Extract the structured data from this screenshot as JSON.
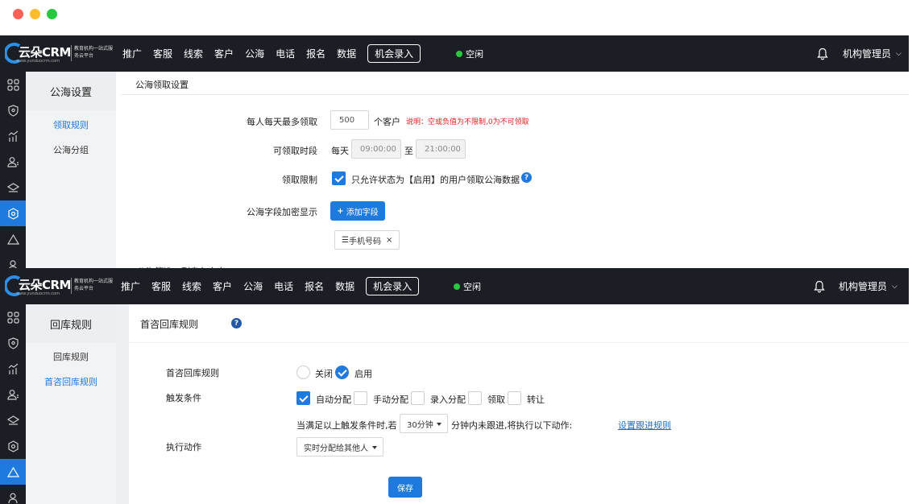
{
  "window": {
    "controls": [
      "close",
      "minimize",
      "zoom"
    ]
  },
  "app": {
    "brand": "云朵CRM",
    "url": "www.yunduocrm.com",
    "slogan": "教育机构一站式服务云平台",
    "nav": [
      "推广",
      "客服",
      "线索",
      "客户",
      "公海",
      "电话",
      "报名",
      "数据"
    ],
    "nav_button": "机会录入",
    "status": "空闲",
    "status_color": "#28c840",
    "user": "机构管理员"
  },
  "panel1": {
    "sidebar_title": "公海设置",
    "sidebar_items": [
      "领取规则",
      "公海分组"
    ],
    "active_item": "领取规则",
    "section_title": "公海领取设置",
    "daily_limit_label": "每人每天最多领取",
    "daily_limit_value": "500",
    "daily_limit_unit": "个客户",
    "daily_limit_note": "说明：空或负值为不限制,0为不可领取",
    "time_label": "可领取时段",
    "time_prefix": "每天",
    "time_start": "09:00:00",
    "time_to": "至",
    "time_end": "21:00:00",
    "restrict_label": "领取限制",
    "restrict_checked": true,
    "restrict_text": "只允许状态为【启用】的用户领取公海数据",
    "encrypt_label": "公海字段加密显示",
    "add_field_button": "添加字段",
    "field_tags": [
      {
        "name": "手机号码"
      }
    ],
    "cutoff_text": "公海筛选，列表各字出"
  },
  "panel2": {
    "sidebar_title": "回库规则",
    "sidebar_items": [
      "回库规则",
      "首咨回库规则"
    ],
    "active_item": "首咨回库规则",
    "page_title": "首咨回库规则",
    "rule_label": "首咨回库规则",
    "rule_options": [
      {
        "label": "关闭",
        "selected": false
      },
      {
        "label": "启用",
        "selected": true
      }
    ],
    "trigger_label": "触发条件",
    "triggers": [
      {
        "label": "自动分配",
        "checked": true
      },
      {
        "label": "手动分配",
        "checked": false
      },
      {
        "label": "录入分配",
        "checked": false
      },
      {
        "label": "领取",
        "checked": false
      },
      {
        "label": "转让",
        "checked": false
      }
    ],
    "condition_prefix": "当满足以上触发条件时,若",
    "minutes_value": "30分钟",
    "condition_suffix": "分钟内未跟进,将执行以下动作:",
    "follow_link": "设置跟进规则",
    "action_label": "执行动作",
    "action_value": "实时分配给其他人",
    "save_button": "保存"
  },
  "colors": {
    "accent": "#1f7ae0",
    "topbar": "#1b1e25",
    "sidebar": "#f2f3f5",
    "warning": "#e02020"
  }
}
